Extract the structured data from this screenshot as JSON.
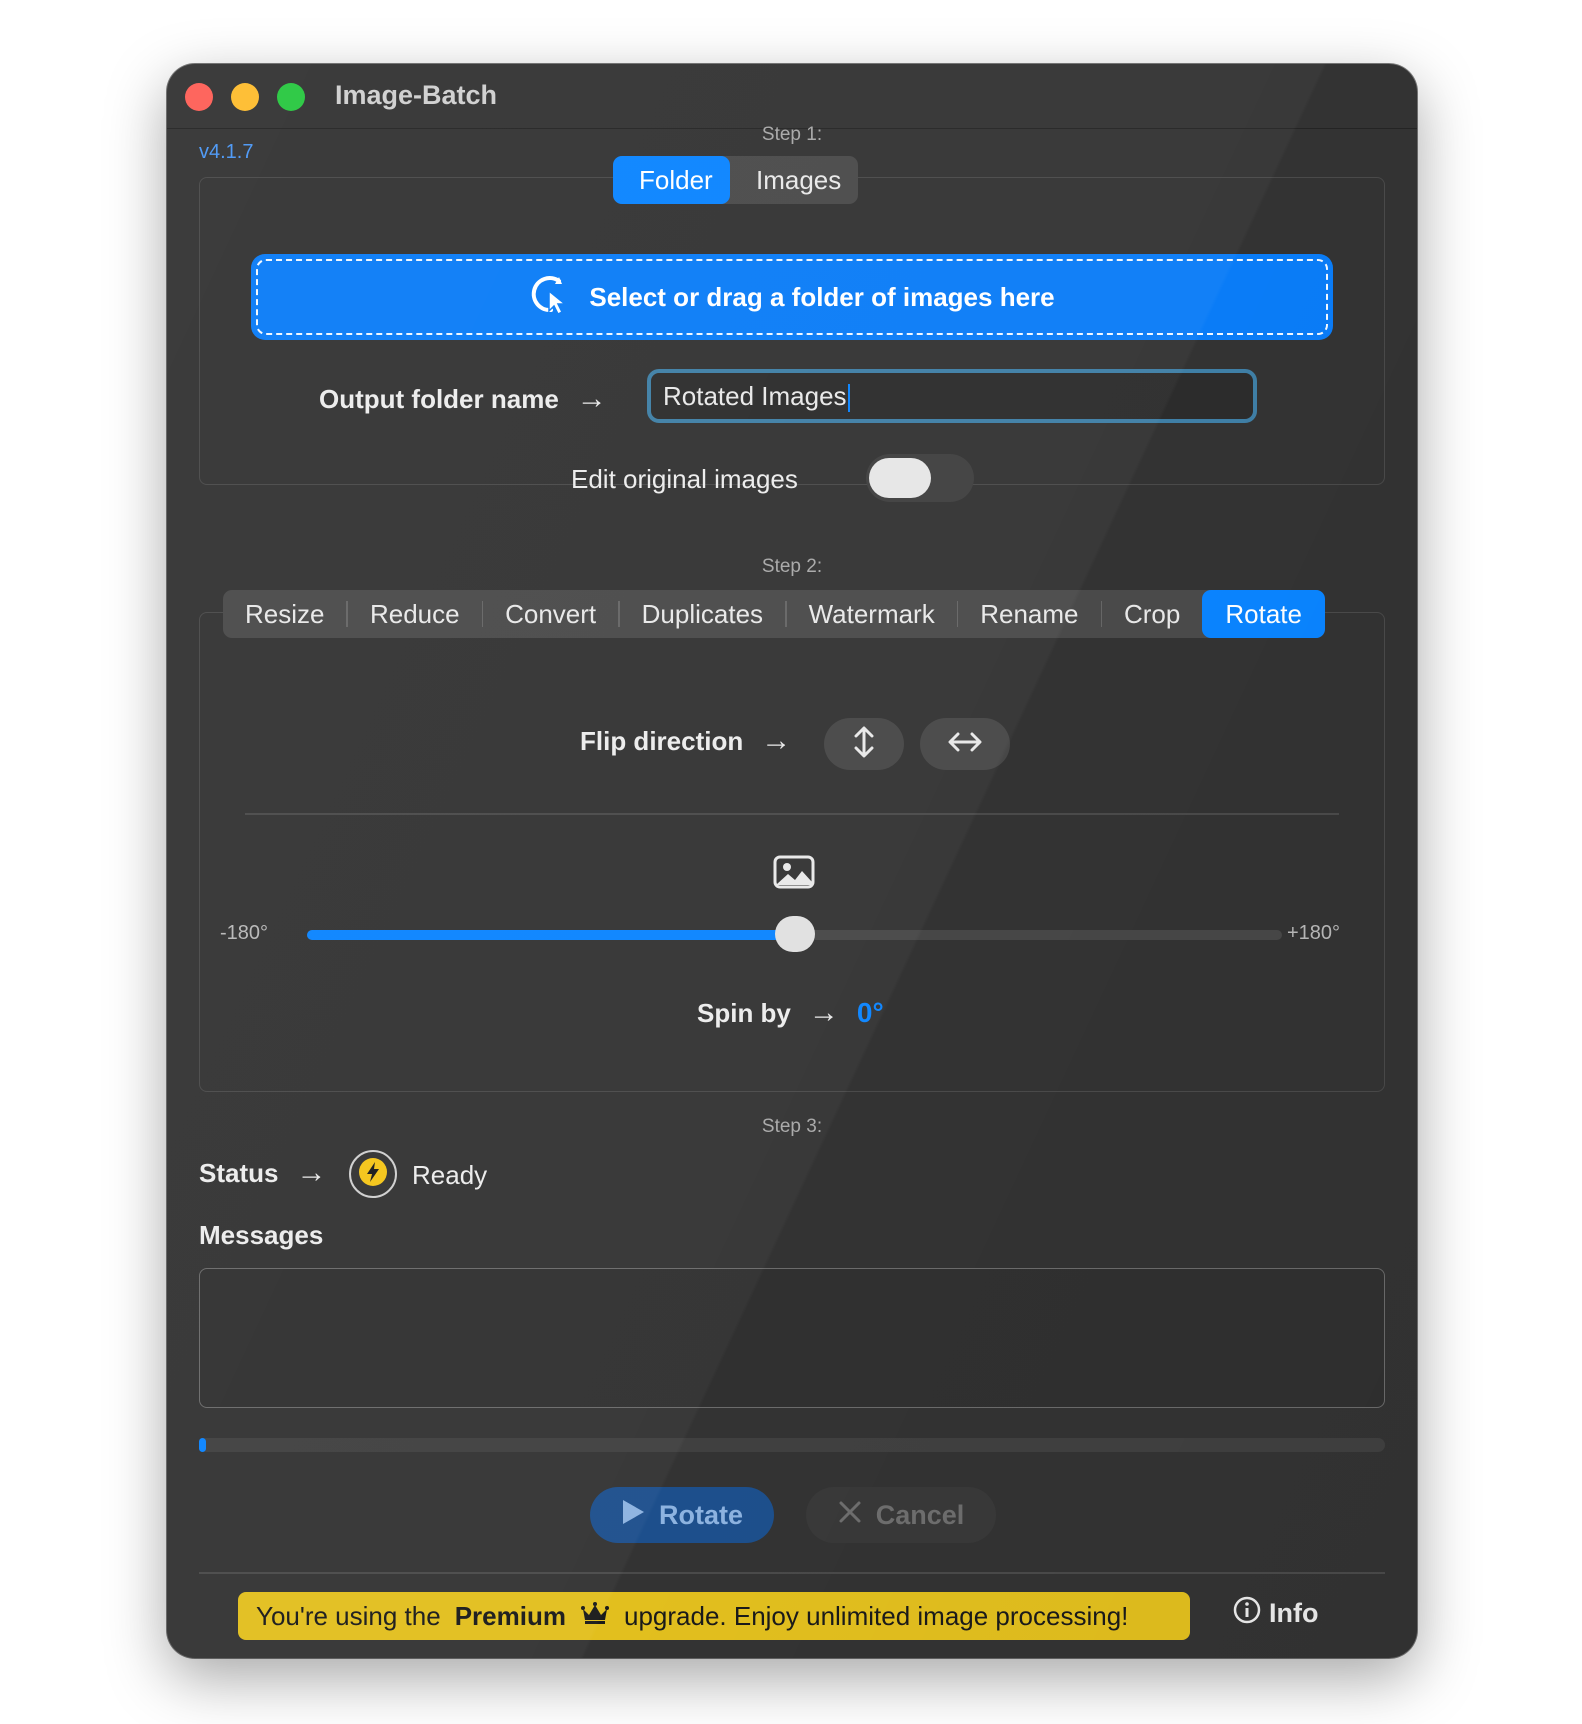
{
  "window": {
    "title": "Image-Batch",
    "version": "v4.1.7"
  },
  "step1": {
    "label": "Step 1:",
    "tabs": [
      {
        "label": "Folder",
        "active": true
      },
      {
        "label": "Images",
        "active": false
      }
    ],
    "dropzone_text": "Select or drag a folder of images here",
    "output_label": "Output folder name",
    "output_value": "Rotated Images",
    "edit_original_label": "Edit original images",
    "edit_original_on": false
  },
  "step2": {
    "label": "Step 2:",
    "tabs": [
      {
        "label": "Resize",
        "active": false
      },
      {
        "label": "Reduce",
        "active": false
      },
      {
        "label": "Convert",
        "active": false
      },
      {
        "label": "Duplicates",
        "active": false
      },
      {
        "label": "Watermark",
        "active": false
      },
      {
        "label": "Rename",
        "active": false
      },
      {
        "label": "Crop",
        "active": false
      },
      {
        "label": "Rotate",
        "active": true
      }
    ],
    "flip_label": "Flip direction",
    "flip_buttons": [
      {
        "icon": "flip-vertical-icon"
      },
      {
        "icon": "flip-horizontal-icon"
      }
    ],
    "slider": {
      "min_label": "-180°",
      "max_label": "+180°",
      "min": -180,
      "max": 180,
      "value": 0
    },
    "spin_label": "Spin by",
    "spin_value": "0°"
  },
  "step3": {
    "label": "Step 3:",
    "status_label": "Status",
    "status_value": "Ready",
    "messages_label": "Messages",
    "progress": 0.0
  },
  "actions": {
    "rotate": "Rotate",
    "cancel": "Cancel"
  },
  "footer": {
    "premium_prefix": "You're using the",
    "premium_word": "Premium",
    "premium_suffix": "upgrade. Enjoy unlimited image processing!",
    "info_label": "Info"
  },
  "colors": {
    "accent": "#0a84ff",
    "premium": "#e2bf1e",
    "background": "#333333"
  }
}
